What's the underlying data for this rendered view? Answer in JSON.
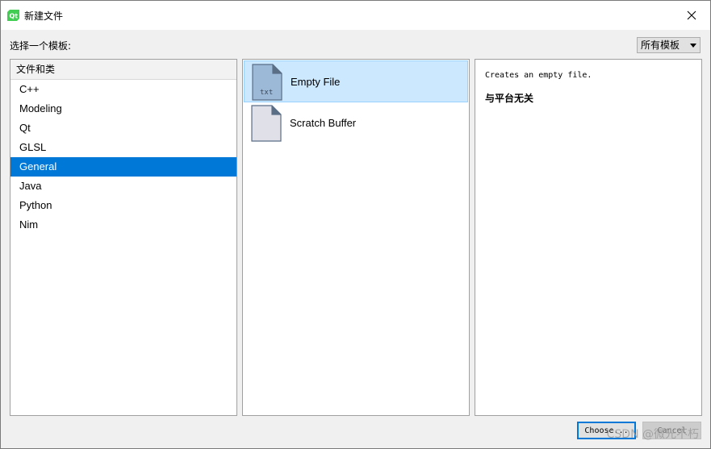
{
  "window": {
    "title": "新建文件",
    "app_icon": "qt-creator-icon",
    "close_icon": "close-icon"
  },
  "prompt": "选择一个模板:",
  "filter": {
    "selected": "所有模板",
    "arrow_icon": "dropdown-arrow-icon"
  },
  "categories": {
    "header": "文件和类",
    "items": [
      "C++",
      "Modeling",
      "Qt",
      "GLSL",
      "General",
      "Java",
      "Python",
      "Nim"
    ],
    "selected": "General"
  },
  "templates": {
    "items": [
      {
        "label": "Empty File",
        "icon": "txt-file-icon",
        "icon_text": "txt",
        "selected": true
      },
      {
        "label": "Scratch Buffer",
        "icon": "blank-file-icon",
        "selected": false
      }
    ]
  },
  "details": {
    "description": "Creates an empty file.",
    "platform": "与平台无关"
  },
  "buttons": {
    "choose": "Choose...",
    "cancel": "Cancel"
  },
  "watermark": "CSDN @微光不朽",
  "colors": {
    "selection_blue": "#0078d7",
    "template_selected_bg": "#cce8ff",
    "template_selected_border": "#99d1ff",
    "qt_green": "#41cd52"
  }
}
